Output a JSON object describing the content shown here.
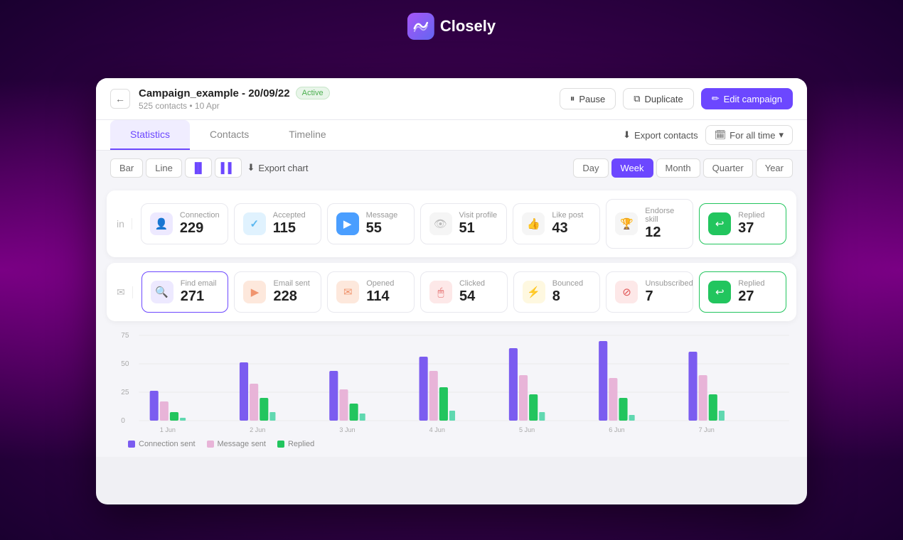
{
  "app": {
    "name": "Closely",
    "logo_emoji": "🌀"
  },
  "header": {
    "back_label": "←",
    "campaign_title": "Campaign_example - 20/09/22",
    "status": "Active",
    "campaign_sub": "525 contacts • 10 Apr",
    "pause_label": "Pause",
    "duplicate_label": "Duplicate",
    "edit_label": "Edit campaign"
  },
  "tabs": {
    "items": [
      {
        "label": "Statistics",
        "active": true
      },
      {
        "label": "Contacts",
        "active": false
      },
      {
        "label": "Timeline",
        "active": false
      }
    ],
    "export_label": "Export contacts",
    "time_filter_label": "For all time"
  },
  "chart_controls": {
    "type_btns": [
      "Bar",
      "Line"
    ],
    "icon_btns": [
      "bar-chart-icon",
      "bar-chart2-icon"
    ],
    "export_label": "Export chart",
    "period_btns": [
      "Day",
      "Week",
      "Month",
      "Quarter",
      "Year"
    ],
    "active_period": "Week"
  },
  "stats_row1": [
    {
      "label": "Connection",
      "value": "229",
      "icon_color": "#7b5cf0",
      "bg_color": "#ede9ff",
      "icon": "👤"
    },
    {
      "label": "Accepted",
      "value": "115",
      "icon_color": "#5cb8f0",
      "bg_color": "#e0f2fe",
      "icon": "✓"
    },
    {
      "label": "Message",
      "value": "55",
      "icon_color": "#5cb8f0",
      "bg_color": "#e0f2fe",
      "icon": "▶"
    },
    {
      "label": "Visit profile",
      "value": "51",
      "icon_color": "#bbb",
      "bg_color": "#f5f5f5",
      "icon": "👁"
    },
    {
      "label": "Like post",
      "value": "43",
      "icon_color": "#bbb",
      "bg_color": "#f5f5f5",
      "icon": "👍"
    },
    {
      "label": "Endorse skill",
      "value": "12",
      "icon_color": "#bbb",
      "bg_color": "#f5f5f5",
      "icon": "🏆"
    },
    {
      "label": "Replied",
      "value": "37",
      "icon_color": "#22c55e",
      "bg_color": "#dcfce7",
      "icon": "↩",
      "highlighted": true
    }
  ],
  "stats_row2": [
    {
      "label": "Find email",
      "value": "271",
      "icon_color": "#7b5cf0",
      "bg_color": "#ede9ff",
      "icon": "🔍"
    },
    {
      "label": "Email sent",
      "value": "228",
      "icon_color": "#f0946e",
      "bg_color": "#fde8dc",
      "icon": "▶"
    },
    {
      "label": "Opened",
      "value": "114",
      "icon_color": "#f0946e",
      "bg_color": "#fde8dc",
      "icon": "✉"
    },
    {
      "label": "Clicked",
      "value": "54",
      "icon_color": "#e05555",
      "bg_color": "#fde8e8",
      "icon": "🖱"
    },
    {
      "label": "Bounced",
      "value": "8",
      "icon_color": "#f0c060",
      "bg_color": "#fef8e0",
      "icon": "⚡"
    },
    {
      "label": "Unsubscribed",
      "value": "7",
      "icon_color": "#e05555",
      "bg_color": "#fde8e8",
      "icon": "⊘"
    },
    {
      "label": "Replied",
      "value": "27",
      "icon_color": "#22c55e",
      "bg_color": "#dcfce7",
      "icon": "↩",
      "highlighted": true
    }
  ],
  "chart": {
    "y_labels": [
      "75",
      "50",
      "25",
      "0"
    ],
    "x_labels": [
      "1 Jun",
      "2 Jun",
      "3 Jun",
      "4 Jun",
      "5 Jun",
      "6 Jun",
      "7 Jun"
    ],
    "legend": [
      {
        "label": "Connection sent",
        "color": "#7b5cf0"
      },
      {
        "label": "Message sent",
        "color": "#f0c0e0"
      },
      {
        "label": "Replied",
        "color": "#22c55e"
      }
    ]
  }
}
